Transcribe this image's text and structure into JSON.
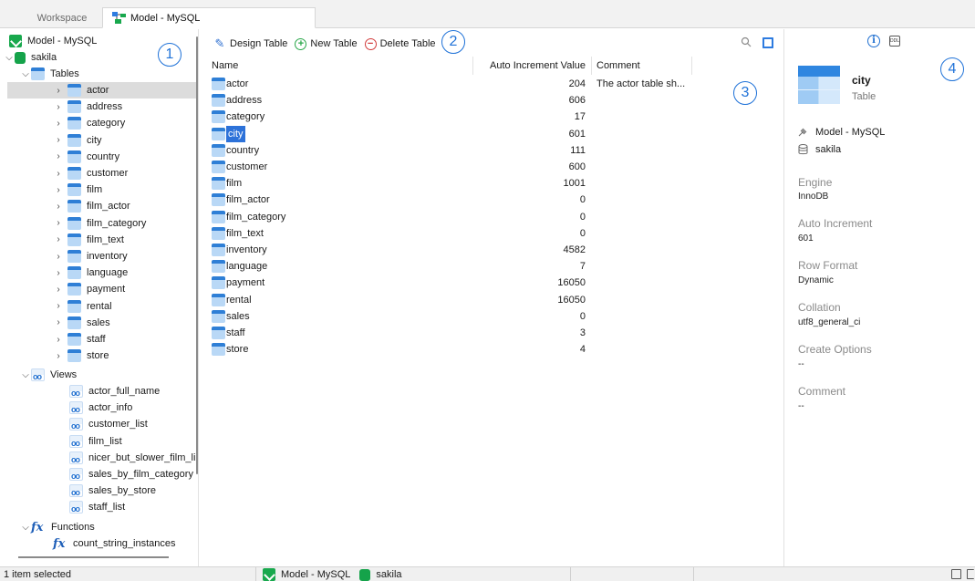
{
  "tabs": [
    {
      "label": "Workspace",
      "active": false
    },
    {
      "label": "Model - MySQL",
      "active": true
    }
  ],
  "tree": {
    "model": "Model - MySQL",
    "database": "sakila",
    "tables_group": "Tables",
    "tables": [
      "actor",
      "address",
      "category",
      "city",
      "country",
      "customer",
      "film",
      "film_actor",
      "film_category",
      "film_text",
      "inventory",
      "language",
      "payment",
      "rental",
      "sales",
      "staff",
      "store"
    ],
    "selected_tree_item": "actor",
    "views_group": "Views",
    "views": [
      "actor_full_name",
      "actor_info",
      "customer_list",
      "film_list",
      "nicer_but_slower_film_li",
      "sales_by_film_category",
      "sales_by_store",
      "staff_list"
    ],
    "functions_group": "Functions",
    "functions": [
      "count_string_instances"
    ]
  },
  "toolbar": {
    "design_table": "Design Table",
    "new_table": "New Table",
    "delete_table": "Delete Table"
  },
  "grid": {
    "headers": {
      "name": "Name",
      "auto_increment": "Auto Increment Value",
      "comment": "Comment"
    },
    "selected_row": "city",
    "rows": [
      {
        "name": "actor",
        "auto": "204",
        "comment": "The actor table sh..."
      },
      {
        "name": "address",
        "auto": "606",
        "comment": ""
      },
      {
        "name": "category",
        "auto": "17",
        "comment": ""
      },
      {
        "name": "city",
        "auto": "601",
        "comment": ""
      },
      {
        "name": "country",
        "auto": "111",
        "comment": ""
      },
      {
        "name": "customer",
        "auto": "600",
        "comment": ""
      },
      {
        "name": "film",
        "auto": "1001",
        "comment": ""
      },
      {
        "name": "film_actor",
        "auto": "0",
        "comment": ""
      },
      {
        "name": "film_category",
        "auto": "0",
        "comment": ""
      },
      {
        "name": "film_text",
        "auto": "0",
        "comment": ""
      },
      {
        "name": "inventory",
        "auto": "4582",
        "comment": ""
      },
      {
        "name": "language",
        "auto": "7",
        "comment": ""
      },
      {
        "name": "payment",
        "auto": "16050",
        "comment": ""
      },
      {
        "name": "rental",
        "auto": "16050",
        "comment": ""
      },
      {
        "name": "sales",
        "auto": "0",
        "comment": ""
      },
      {
        "name": "staff",
        "auto": "3",
        "comment": ""
      },
      {
        "name": "store",
        "auto": "4",
        "comment": ""
      }
    ]
  },
  "info": {
    "info_icon_text": "i",
    "ddl_icon_text": "DDL",
    "name": "city",
    "type": "Table",
    "model": "Model - MySQL",
    "database": "sakila",
    "properties": [
      {
        "label": "Engine",
        "value": "InnoDB"
      },
      {
        "label": "Auto Increment",
        "value": "601"
      },
      {
        "label": "Row Format",
        "value": "Dynamic"
      },
      {
        "label": "Collation",
        "value": "utf8_general_ci"
      },
      {
        "label": "Create Options",
        "value": "--"
      },
      {
        "label": "Comment",
        "value": "--"
      }
    ]
  },
  "status": {
    "selection": "1 item selected",
    "model": "Model - MySQL",
    "database": "sakila"
  },
  "callouts": [
    "1",
    "2",
    "3",
    "4"
  ],
  "colors": {
    "accent": "#2d72d9",
    "db_green": "#15a34a",
    "tree_selection": "#dcdcdc"
  }
}
